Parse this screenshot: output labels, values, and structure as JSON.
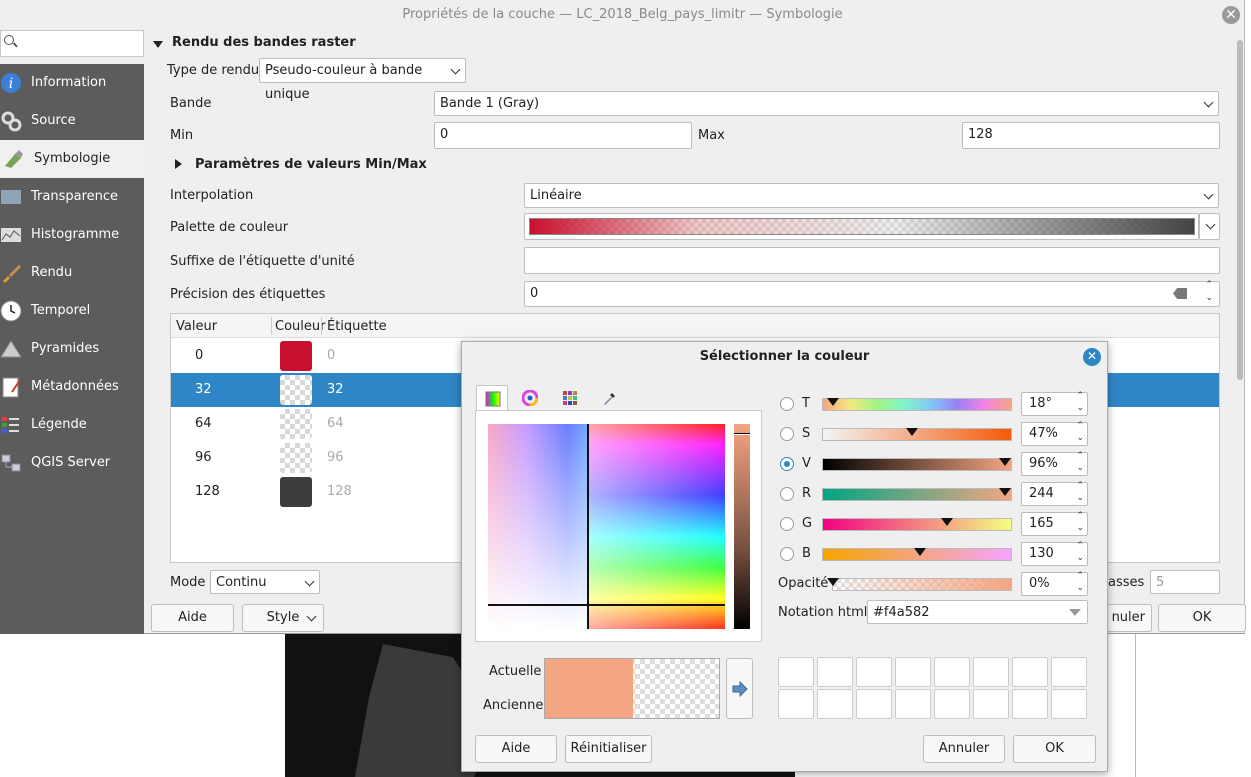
{
  "window": {
    "title": "Propriétés de la couche — LC_2018_Belg_pays_limitr — Symbologie"
  },
  "search": {
    "placeholder": ""
  },
  "sidebar": {
    "items": [
      {
        "label": "Information",
        "icon": "info-icon"
      },
      {
        "label": "Source",
        "icon": "source-icon"
      },
      {
        "label": "Symbologie",
        "icon": "symbology-icon",
        "selected": true
      },
      {
        "label": "Transparence",
        "icon": "transparency-icon"
      },
      {
        "label": "Histogramme",
        "icon": "histogram-icon"
      },
      {
        "label": "Rendu",
        "icon": "brush-icon"
      },
      {
        "label": "Temporel",
        "icon": "clock-icon"
      },
      {
        "label": "Pyramides",
        "icon": "pyramid-icon"
      },
      {
        "label": "Métadonnées",
        "icon": "metadata-icon"
      },
      {
        "label": "Légende",
        "icon": "legend-icon"
      },
      {
        "label": "QGIS Server",
        "icon": "server-icon"
      }
    ]
  },
  "panel": {
    "section_title": "Rendu des bandes raster",
    "render_type_label": "Type de rendu",
    "render_type_value": "Pseudo-couleur à bande unique",
    "band_label": "Bande",
    "band_value": "Bande 1 (Gray)",
    "min_label": "Min",
    "min_value": "0",
    "max_label": "Max",
    "max_value": "128",
    "minmax_section": "Paramètres de valeurs Min/Max",
    "interpolation_label": "Interpolation",
    "interpolation_value": "Linéaire",
    "palette_label": "Palette de couleur",
    "unit_suffix_label": "Suffixe de l'étiquette d'unité",
    "unit_suffix_value": "",
    "precision_label": "Précision des étiquettes",
    "precision_value": "0",
    "table": {
      "headers": [
        "Valeur",
        "Couleur",
        "Étiquette"
      ],
      "rows": [
        {
          "value": "0",
          "label": "0",
          "color": "#c8102e"
        },
        {
          "value": "32",
          "label": "32",
          "color": "transparent",
          "selected": true
        },
        {
          "value": "64",
          "label": "64",
          "color": "transparent"
        },
        {
          "value": "96",
          "label": "96",
          "color": "transparent"
        },
        {
          "value": "128",
          "label": "128",
          "color": "#3d3d3d"
        }
      ]
    },
    "mode_label": "Mode",
    "mode_value": "Continu",
    "classes_label": "asses",
    "classes_value": "5"
  },
  "footer": {
    "help": "Aide",
    "style": "Style",
    "cancel_partial": "nuler",
    "ok": "OK"
  },
  "dialog": {
    "title": "Sélectionner la couleur",
    "sliders": [
      {
        "key": "T",
        "value": "18°",
        "pos": 0.05,
        "selected": false
      },
      {
        "key": "S",
        "value": "47%",
        "pos": 0.47,
        "selected": false
      },
      {
        "key": "V",
        "value": "96%",
        "pos": 0.96,
        "selected": true
      },
      {
        "key": "R",
        "value": "244",
        "pos": 0.96,
        "selected": false
      },
      {
        "key": "G",
        "value": "165",
        "pos": 0.65,
        "selected": false
      },
      {
        "key": "B",
        "value": "130",
        "pos": 0.51,
        "selected": false
      }
    ],
    "opacity_label": "Opacité",
    "opacity_value": "0%",
    "html_label": "Notation html",
    "html_value": "#f4a582",
    "current_label": "Actuelle",
    "old_label": "Ancienne",
    "current_color": "#f4a582",
    "help": "Aide",
    "reset": "Réinitialiser",
    "cancel": "Annuler",
    "ok": "OK"
  }
}
